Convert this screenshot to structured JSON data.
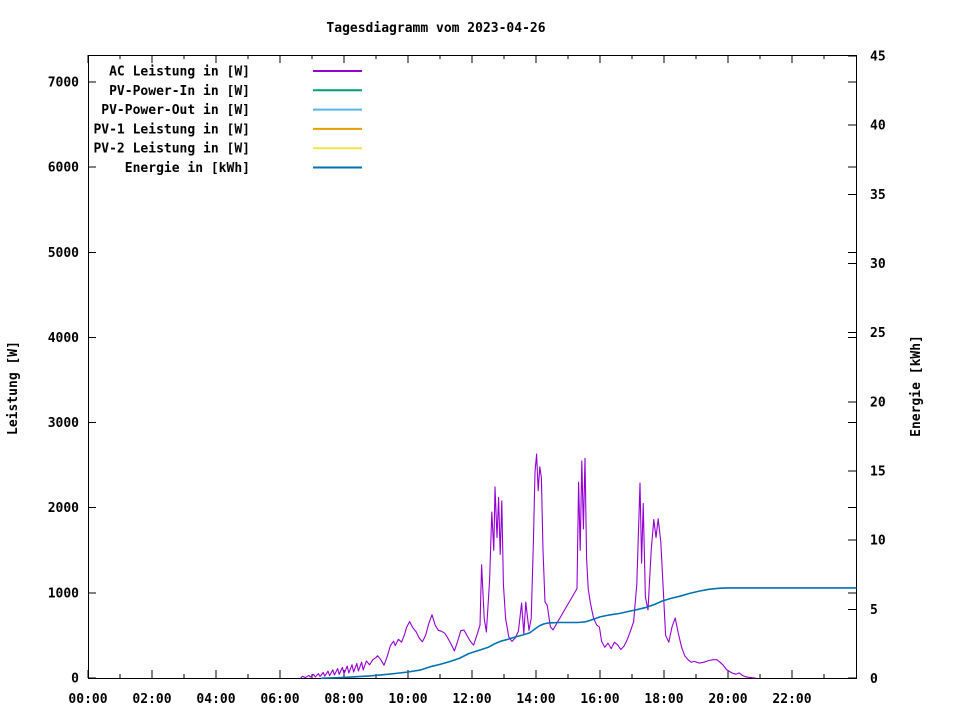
{
  "chart_data": {
    "type": "line",
    "title": "Tagesdiagramm vom 2023-04-26",
    "x_axis": {
      "unit": "time of day",
      "range_hours": [
        0,
        24
      ],
      "major_ticks": [
        {
          "hour": 0,
          "label": "00:00"
        },
        {
          "hour": 2,
          "label": "02:00"
        },
        {
          "hour": 4,
          "label": "04:00"
        },
        {
          "hour": 6,
          "label": "06:00"
        },
        {
          "hour": 8,
          "label": "08:00"
        },
        {
          "hour": 10,
          "label": "10:00"
        },
        {
          "hour": 12,
          "label": "12:00"
        },
        {
          "hour": 14,
          "label": "14:00"
        },
        {
          "hour": 16,
          "label": "16:00"
        },
        {
          "hour": 18,
          "label": "18:00"
        },
        {
          "hour": 20,
          "label": "20:00"
        },
        {
          "hour": 22,
          "label": "22:00"
        }
      ],
      "minor_tick_hours": [
        1,
        3,
        5,
        7,
        9,
        11,
        13,
        15,
        17,
        19,
        21,
        23
      ]
    },
    "y_left": {
      "label": "Leistung [W]",
      "ticks": [
        0,
        1000,
        2000,
        3000,
        4000,
        5000,
        6000,
        7000
      ],
      "range": [
        0,
        7320
      ]
    },
    "y_right": {
      "label": "Energie [kWh]",
      "ticks": [
        0,
        5,
        10,
        15,
        20,
        25,
        30,
        35,
        40,
        45
      ],
      "range": [
        0,
        45
      ]
    },
    "legend_position": "top-left-inside",
    "grid": false,
    "series": [
      {
        "label": "AC Leistung in [W]",
        "color": "#9400d3",
        "axis": "left",
        "has_visible_data": true,
        "points": [
          [
            6.65,
            0
          ],
          [
            6.7,
            20
          ],
          [
            6.8,
            5
          ],
          [
            6.9,
            30
          ],
          [
            6.95,
            10
          ],
          [
            7.05,
            42
          ],
          [
            7.1,
            12
          ],
          [
            7.2,
            52
          ],
          [
            7.25,
            18
          ],
          [
            7.35,
            65
          ],
          [
            7.4,
            22
          ],
          [
            7.5,
            80
          ],
          [
            7.55,
            28
          ],
          [
            7.65,
            95
          ],
          [
            7.7,
            35
          ],
          [
            7.8,
            110
          ],
          [
            7.85,
            42
          ],
          [
            7.95,
            125
          ],
          [
            8.0,
            50
          ],
          [
            8.1,
            140
          ],
          [
            8.15,
            60
          ],
          [
            8.25,
            155
          ],
          [
            8.3,
            70
          ],
          [
            8.4,
            170
          ],
          [
            8.45,
            82
          ],
          [
            8.55,
            185
          ],
          [
            8.6,
            95
          ],
          [
            8.7,
            200
          ],
          [
            8.8,
            155
          ],
          [
            8.9,
            215
          ],
          [
            9.0,
            240
          ],
          [
            9.05,
            262
          ],
          [
            9.15,
            215
          ],
          [
            9.25,
            150
          ],
          [
            9.35,
            250
          ],
          [
            9.45,
            380
          ],
          [
            9.55,
            432
          ],
          [
            9.6,
            380
          ],
          [
            9.7,
            455
          ],
          [
            9.8,
            420
          ],
          [
            9.9,
            520
          ],
          [
            9.95,
            590
          ],
          [
            10.05,
            662
          ],
          [
            10.15,
            590
          ],
          [
            10.25,
            545
          ],
          [
            10.35,
            470
          ],
          [
            10.45,
            425
          ],
          [
            10.55,
            500
          ],
          [
            10.65,
            640
          ],
          [
            10.75,
            742
          ],
          [
            10.85,
            620
          ],
          [
            10.95,
            560
          ],
          [
            11.05,
            548
          ],
          [
            11.15,
            525
          ],
          [
            11.25,
            465
          ],
          [
            11.35,
            395
          ],
          [
            11.45,
            318
          ],
          [
            11.55,
            430
          ],
          [
            11.65,
            555
          ],
          [
            11.75,
            562
          ],
          [
            11.85,
            495
          ],
          [
            11.95,
            430
          ],
          [
            12.05,
            385
          ],
          [
            12.15,
            500
          ],
          [
            12.25,
            620
          ],
          [
            12.3,
            1330
          ],
          [
            12.38,
            700
          ],
          [
            12.45,
            540
          ],
          [
            12.55,
            1150
          ],
          [
            12.62,
            1950
          ],
          [
            12.68,
            1500
          ],
          [
            12.72,
            2245
          ],
          [
            12.78,
            1650
          ],
          [
            12.83,
            2120
          ],
          [
            12.88,
            1450
          ],
          [
            12.93,
            2080
          ],
          [
            12.98,
            1100
          ],
          [
            13.05,
            700
          ],
          [
            13.15,
            480
          ],
          [
            13.25,
            430
          ],
          [
            13.35,
            470
          ],
          [
            13.45,
            550
          ],
          [
            13.55,
            880
          ],
          [
            13.62,
            520
          ],
          [
            13.68,
            890
          ],
          [
            13.78,
            560
          ],
          [
            13.85,
            700
          ],
          [
            13.92,
            1600
          ],
          [
            13.97,
            2420
          ],
          [
            14.02,
            2630
          ],
          [
            14.07,
            2200
          ],
          [
            14.12,
            2480
          ],
          [
            14.17,
            2350
          ],
          [
            14.22,
            1500
          ],
          [
            14.28,
            890
          ],
          [
            14.35,
            855
          ],
          [
            14.45,
            600
          ],
          [
            14.53,
            565
          ],
          [
            15.28,
            1050
          ],
          [
            15.33,
            2300
          ],
          [
            15.38,
            1500
          ],
          [
            15.43,
            2550
          ],
          [
            15.48,
            1750
          ],
          [
            15.53,
            2580
          ],
          [
            15.58,
            1400
          ],
          [
            15.63,
            1050
          ],
          [
            15.7,
            880
          ],
          [
            15.8,
            700
          ],
          [
            15.9,
            620
          ],
          [
            15.98,
            598
          ],
          [
            16.05,
            430
          ],
          [
            16.15,
            360
          ],
          [
            16.25,
            410
          ],
          [
            16.35,
            345
          ],
          [
            16.45,
            420
          ],
          [
            16.55,
            390
          ],
          [
            16.65,
            335
          ],
          [
            16.75,
            375
          ],
          [
            16.85,
            450
          ],
          [
            16.95,
            550
          ],
          [
            17.05,
            660
          ],
          [
            17.15,
            1100
          ],
          [
            17.25,
            2290
          ],
          [
            17.3,
            1350
          ],
          [
            17.35,
            2050
          ],
          [
            17.42,
            950
          ],
          [
            17.5,
            800
          ],
          [
            17.6,
            1500
          ],
          [
            17.68,
            1860
          ],
          [
            17.75,
            1650
          ],
          [
            17.82,
            1870
          ],
          [
            17.9,
            1600
          ],
          [
            17.97,
            1100
          ],
          [
            18.05,
            500
          ],
          [
            18.15,
            420
          ],
          [
            18.25,
            600
          ],
          [
            18.35,
            705
          ],
          [
            18.45,
            520
          ],
          [
            18.55,
            360
          ],
          [
            18.65,
            260
          ],
          [
            18.75,
            215
          ],
          [
            18.85,
            185
          ],
          [
            18.95,
            195
          ],
          [
            19.1,
            175
          ],
          [
            19.25,
            185
          ],
          [
            19.4,
            205
          ],
          [
            19.55,
            215
          ],
          [
            19.65,
            215
          ],
          [
            19.75,
            185
          ],
          [
            19.85,
            150
          ],
          [
            19.95,
            100
          ],
          [
            20.05,
            75
          ],
          [
            20.15,
            55
          ],
          [
            20.25,
            45
          ],
          [
            20.35,
            60
          ],
          [
            20.45,
            30
          ],
          [
            20.55,
            15
          ],
          [
            20.65,
            8
          ],
          [
            20.75,
            3
          ],
          [
            20.85,
            0
          ]
        ]
      },
      {
        "label": "PV-Power-In in [W]",
        "color": "#009e73",
        "axis": "left",
        "has_visible_data": false,
        "points": []
      },
      {
        "label": "PV-Power-Out in [W]",
        "color": "#56b4e9",
        "axis": "left",
        "has_visible_data": false,
        "points": []
      },
      {
        "label": "PV-1 Leistung in [W]",
        "color": "#e69f00",
        "axis": "left",
        "has_visible_data": false,
        "points": []
      },
      {
        "label": "PV-2 Leistung in [W]",
        "color": "#f0e442",
        "axis": "left",
        "has_visible_data": false,
        "points": []
      },
      {
        "label": "Energie in [kWh]",
        "color": "#0072b2",
        "axis": "right",
        "has_visible_data": true,
        "points": [
          [
            7.3,
            0.02
          ],
          [
            7.6,
            0.04
          ],
          [
            8.0,
            0.08
          ],
          [
            8.4,
            0.13
          ],
          [
            8.8,
            0.19
          ],
          [
            9.2,
            0.27
          ],
          [
            9.6,
            0.36
          ],
          [
            10.0,
            0.47
          ],
          [
            10.4,
            0.62
          ],
          [
            10.7,
            0.85
          ],
          [
            11.0,
            1.02
          ],
          [
            11.3,
            1.22
          ],
          [
            11.6,
            1.45
          ],
          [
            11.9,
            1.8
          ],
          [
            12.1,
            1.95
          ],
          [
            12.3,
            2.1
          ],
          [
            12.5,
            2.25
          ],
          [
            12.7,
            2.5
          ],
          [
            12.9,
            2.7
          ],
          [
            13.1,
            2.82
          ],
          [
            13.35,
            3.0
          ],
          [
            13.6,
            3.15
          ],
          [
            13.8,
            3.3
          ],
          [
            13.95,
            3.55
          ],
          [
            14.1,
            3.8
          ],
          [
            14.25,
            3.95
          ],
          [
            14.4,
            4.02
          ],
          [
            14.7,
            4.05
          ],
          [
            15.0,
            4.05
          ],
          [
            15.3,
            4.05
          ],
          [
            15.55,
            4.1
          ],
          [
            15.75,
            4.25
          ],
          [
            16.0,
            4.45
          ],
          [
            16.3,
            4.6
          ],
          [
            16.6,
            4.7
          ],
          [
            16.9,
            4.85
          ],
          [
            17.2,
            5.0
          ],
          [
            17.45,
            5.15
          ],
          [
            17.7,
            5.35
          ],
          [
            17.95,
            5.6
          ],
          [
            18.2,
            5.78
          ],
          [
            18.5,
            5.95
          ],
          [
            18.8,
            6.15
          ],
          [
            19.1,
            6.32
          ],
          [
            19.4,
            6.45
          ],
          [
            19.7,
            6.52
          ],
          [
            20.0,
            6.55
          ],
          [
            20.5,
            6.55
          ],
          [
            21.0,
            6.55
          ],
          [
            22.0,
            6.55
          ],
          [
            23.0,
            6.55
          ],
          [
            24.0,
            6.55
          ]
        ]
      }
    ]
  }
}
